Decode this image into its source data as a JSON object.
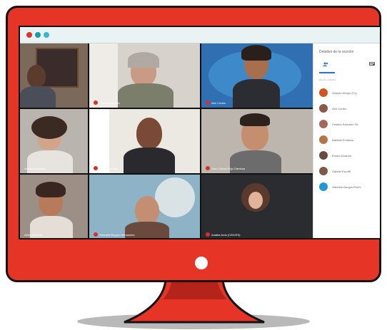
{
  "window": {
    "controls": [
      "close-dot",
      "minimize-dot",
      "maximize-dot"
    ],
    "colors": {
      "red": "#e23127",
      "teal1": "#119fb0",
      "teal2": "#36b6d1"
    }
  },
  "meeting": {
    "tiles": [
      {
        "name": ""
      },
      {
        "name": "Carmen Antonio"
      },
      {
        "name": "Abri Cortes"
      },
      {
        "name": "Ximena Sanchez"
      },
      {
        "name": "Fernando Ruiz"
      },
      {
        "name": "Juan Carlos Rojo Gamboa"
      },
      {
        "name": "Alicia Jimenez"
      },
      {
        "name": "Gabriela Burgos Hernandez"
      },
      {
        "name": "Anabia Ardo (CINVES)"
      }
    ]
  },
  "panel": {
    "title": "Detalles de la reunión",
    "section_label": "EN LA LLAMADA",
    "participants": [
      {
        "name": "Octavio Arroyo (Tú)",
        "color": "#d4541f"
      },
      {
        "name": "Abri Cortes",
        "color": "#8a5a4a"
      },
      {
        "name": "Cristina Sanchez Gil",
        "color": "#a7685a"
      },
      {
        "name": "Daniela Emiliano",
        "color": "#b5734a"
      },
      {
        "name": "Emma Dorador",
        "color": "#6b4b3e"
      },
      {
        "name": "Gabriel Escoffi",
        "color": "#7d5a4a"
      },
      {
        "name": "Gabriela Burgos Pérez",
        "color": "#1f9ad6"
      }
    ]
  },
  "monitor": {
    "frame_color": "#e63427",
    "outline_color": "#141414"
  }
}
